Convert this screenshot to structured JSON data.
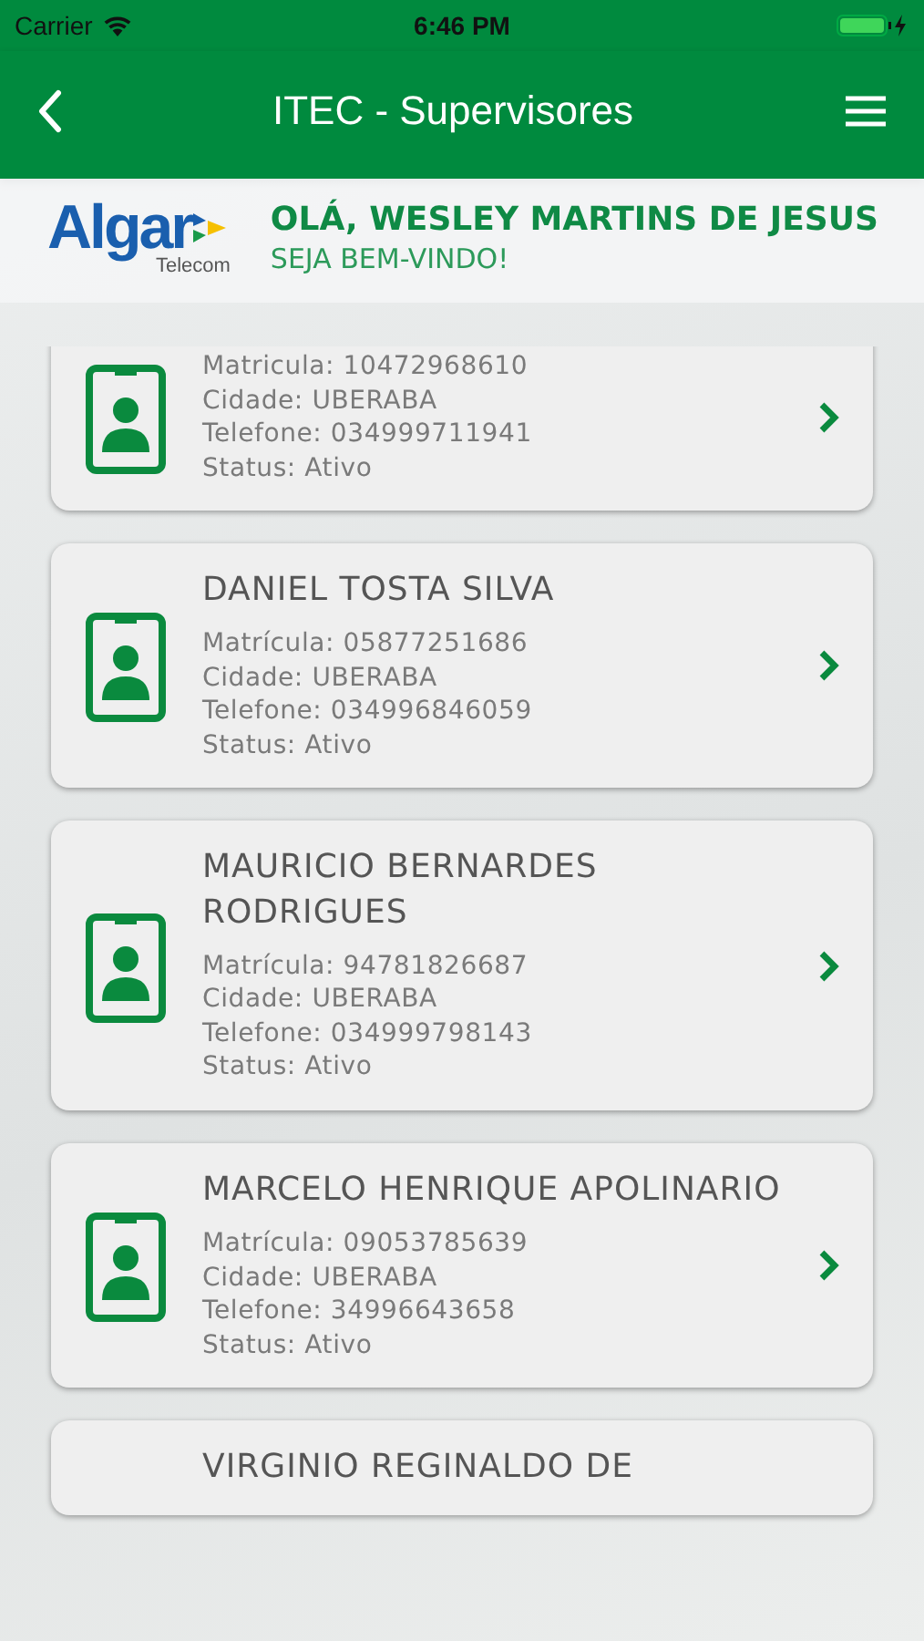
{
  "status_bar": {
    "carrier": "Carrier",
    "time": "6:46 PM"
  },
  "nav_bar": {
    "title": "ITEC - Supervisores"
  },
  "header": {
    "logo_text": "Algar",
    "logo_subtext": "Telecom",
    "greeting": "OLÁ, WESLEY MARTINS DE JESUS",
    "welcome": "SEJA BEM-VINDO!"
  },
  "supervisors": [
    {
      "fields": [
        "Matricula: 10472968610",
        "Cidade: UBERABA",
        "Telefone: 034999711941",
        "Status: Ativo"
      ]
    },
    {
      "name": "DANIEL TOSTA SILVA",
      "fields": [
        "Matrícula: 05877251686",
        "Cidade: UBERABA",
        "Telefone: 034996846059",
        "Status: Ativo"
      ]
    },
    {
      "name": "MAURICIO BERNARDES RODRIGUES",
      "fields": [
        "Matrícula: 94781826687",
        "Cidade: UBERABA",
        "Telefone: 034999798143",
        "Status: Ativo"
      ]
    },
    {
      "name": "MARCELO HENRIQUE APOLINARIO",
      "fields": [
        "Matrícula: 09053785639",
        "Cidade: UBERABA",
        "Telefone: 34996643658",
        "Status: Ativo"
      ]
    },
    {
      "name": "VIRGINIO REGINALDO DE"
    }
  ]
}
